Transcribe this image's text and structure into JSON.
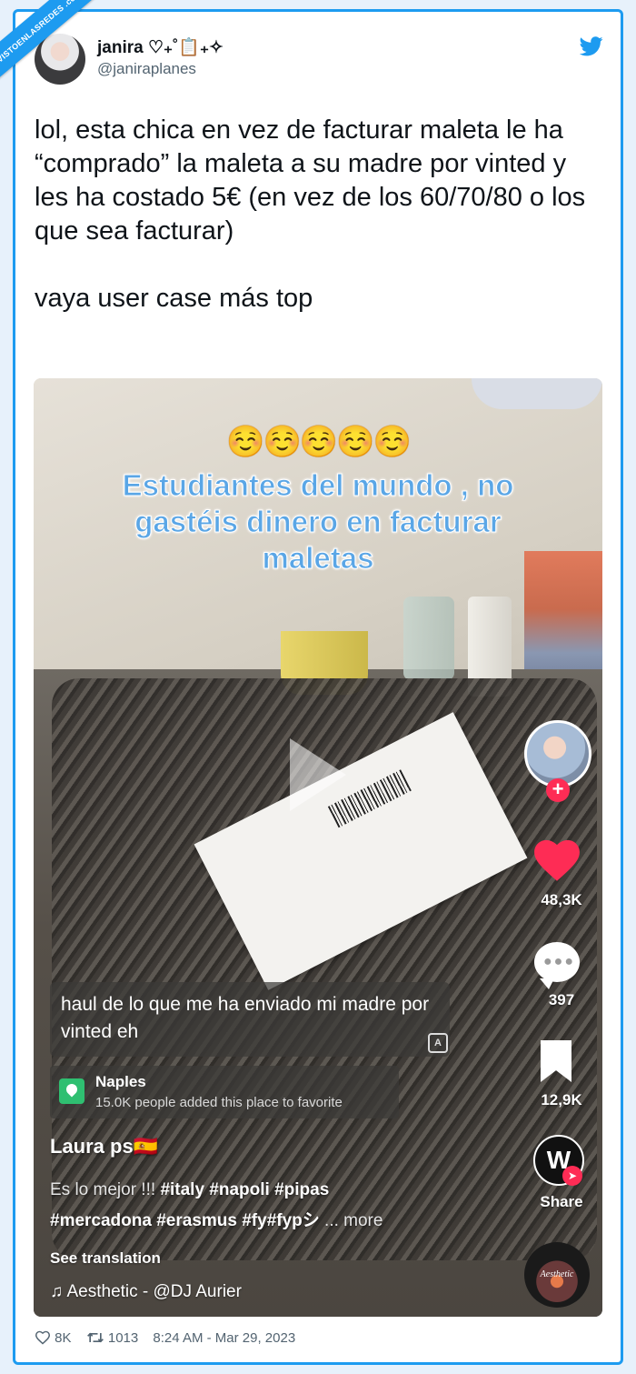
{
  "watermark": "VISTOENLASREDES .com",
  "author": {
    "name": "janira ♡₊˚📋₊✧",
    "handle": "@janiraplanes"
  },
  "tweet": {
    "text": "lol, esta chica en vez de facturar maleta le ha “comprado” la maleta a su madre por vinted y les ha costado 5€ (en vez de los 60/70/80 o los que sea facturar)\n\nvaya user case más top"
  },
  "video": {
    "emojis": "☺️☺️☺️☺️☺️",
    "overlay_title": "Estudiantes del mundo , no\ngastéis dinero en facturar\nmaletas",
    "caption": "haul de lo que me ha enviado mi madre por vinted eh",
    "location": {
      "name": "Naples",
      "subtitle": "15.0K people added this place to favorite"
    },
    "user": "Laura ps🇪🇸",
    "description_prefix": "Es lo mejor !!!",
    "description_tags_1": "#italy #napoli #pipas",
    "description_tags_2": "#mercadona #erasmus #fy#fypシ",
    "more_label": "... more",
    "see_translation": "See translation",
    "music": "♫ Aesthetic - @DJ Aurier",
    "likes": "48,3K",
    "comments": "397",
    "saves": "12,9K",
    "share_label": "Share",
    "disc_label": "Aesthetic",
    "share_glyph": "W"
  },
  "footer": {
    "likes": "8K",
    "retweets": "1013",
    "timestamp": "8:24 AM - Mar 29, 2023"
  },
  "colors": {
    "twitter_blue": "#1d9bf0",
    "tiktok_red": "#fe2c55"
  }
}
